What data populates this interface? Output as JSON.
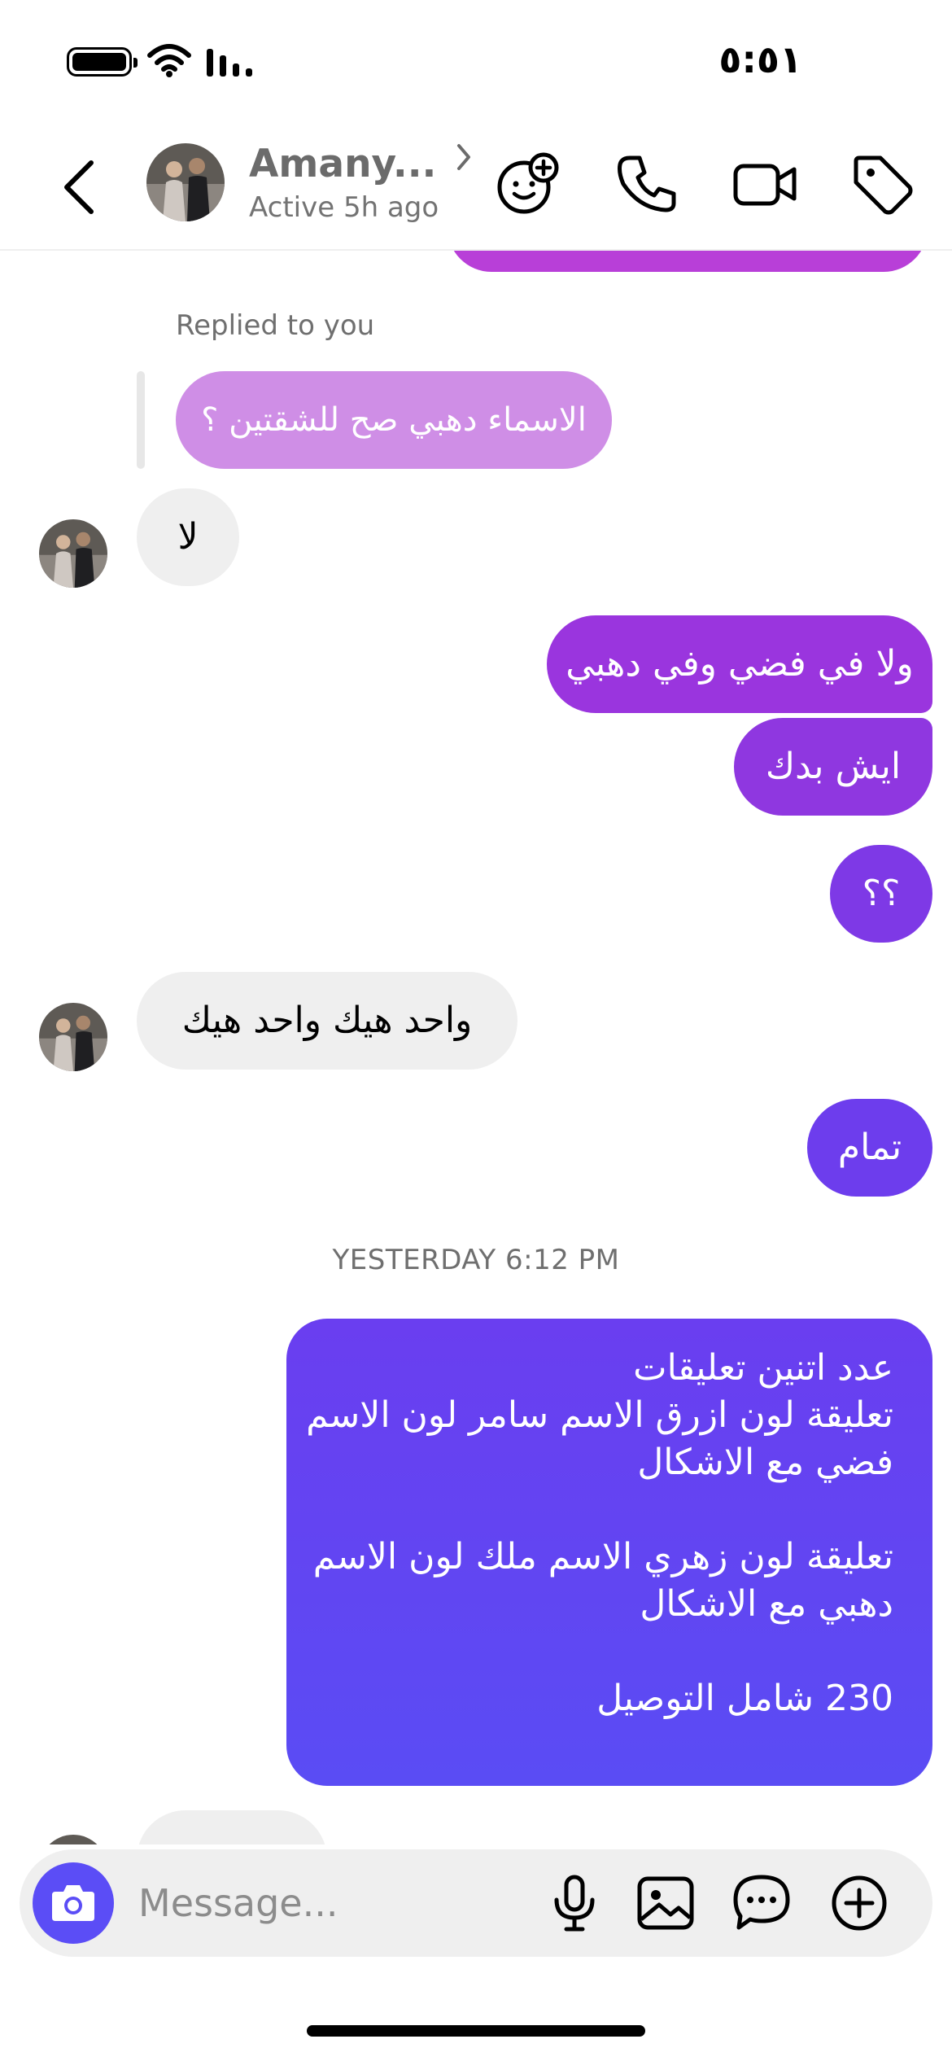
{
  "status_bar": {
    "time": "٥:٥١"
  },
  "header": {
    "contact_name": "Amany...",
    "status": "Active 5h ago",
    "icons": [
      "back-icon",
      "effects-sticker-icon",
      "phone-icon",
      "video-icon",
      "tag-icon"
    ]
  },
  "chat": {
    "reply_label": "Replied to you",
    "replied_text": "الاسماء دهبي صح للشقتين ؟",
    "messages": [
      {
        "from": "them",
        "text": "لا"
      },
      {
        "from": "me",
        "text": "ولا في فضي وفي دهبي"
      },
      {
        "from": "me",
        "text": "ايش بدك"
      },
      {
        "from": "me",
        "text": "؟؟"
      },
      {
        "from": "them",
        "text": "واحد هيك واحد هيك"
      },
      {
        "from": "me",
        "text": "تمام"
      }
    ],
    "timestamp": "YESTERDAY 6:12 PM",
    "order_message": {
      "line1": "عدد اتنين تعليقات",
      "line2": "تعليقة لون ازرق الاسم سامر لون الاسم",
      "line3": "فضي مع الاشكال",
      "line4": "تعليقة لون زهري الاسم ملك لون الاسم",
      "line5": "دهبي مع الاشكال",
      "line6": "230 شامل التوصيل"
    }
  },
  "composer": {
    "placeholder": "Message...",
    "icons": [
      "camera-icon",
      "microphone-icon",
      "gallery-icon",
      "chat-bubble-icon",
      "add-icon"
    ]
  },
  "colors": {
    "bubble_top": "#b83fd8",
    "bubble_mid": "#7c3ae8",
    "bubble_bottom": "#5a4cf4",
    "accent": "#5b4df6",
    "incoming": "#efefef"
  }
}
